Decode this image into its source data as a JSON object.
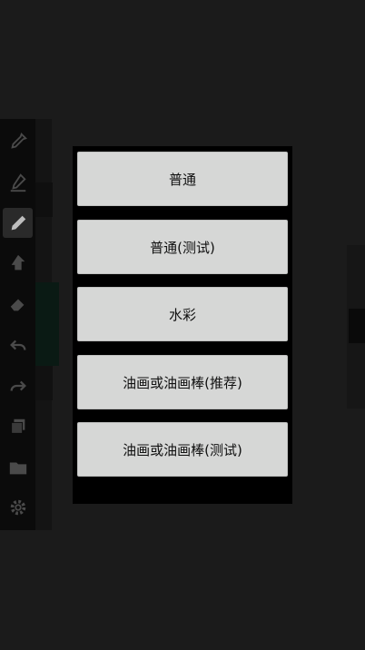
{
  "dialog": {
    "options": [
      {
        "label": "普通"
      },
      {
        "label": "普通(测试)"
      },
      {
        "label": "水彩"
      },
      {
        "label": "油画或油画棒(推荐)"
      },
      {
        "label": "油画或油画棒(测试)"
      }
    ]
  },
  "toolbar": {
    "tools": [
      {
        "icon": "eyedropper-icon"
      },
      {
        "icon": "eyedropper-pen-icon"
      },
      {
        "icon": "pencil-icon"
      },
      {
        "icon": "smudge-icon"
      },
      {
        "icon": "eraser-icon"
      },
      {
        "icon": "undo-icon"
      },
      {
        "icon": "redo-icon"
      },
      {
        "icon": "layers-icon"
      },
      {
        "icon": "folder-icon"
      },
      {
        "icon": "settings-gear-icon"
      }
    ],
    "active_tool": "pencil-icon"
  },
  "colors": {
    "background": "#1b1b1b",
    "toolbar": "#0b0b0b",
    "dialog": "#000000",
    "option_button": "#d6d7d6",
    "icon_dim": "#4a4a4a",
    "icon_active": "#bdbdbd"
  }
}
